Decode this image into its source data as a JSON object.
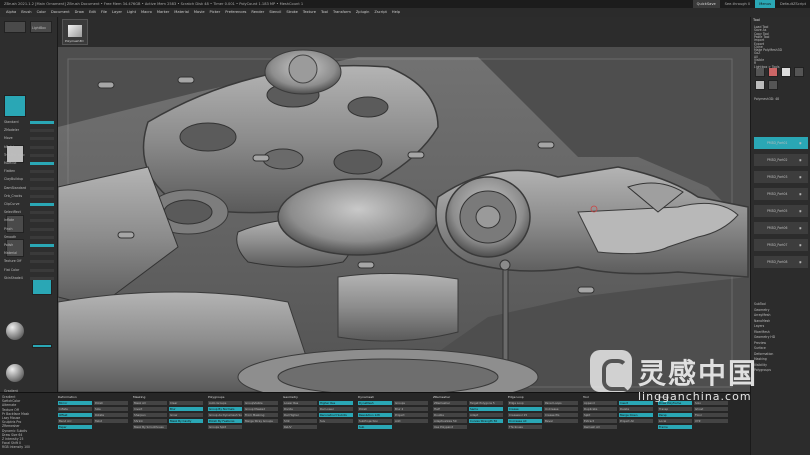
{
  "app": {
    "title": "ZBrush 2021.1.2 [Main Ornament]  ZBrush Document  • Free Mem 34.476GB • Active Mem 2583 • Scratch Disk 48 • Timer 0.001 • PolyCount 1.183 MP • MeshCount 1",
    "quicksave": "QuickSave",
    "see_through": "See-through 0",
    "menus": "Menus",
    "default_zscript": "DefaultZScript"
  },
  "menu_bar": [
    "Alpha",
    "Brush",
    "Color",
    "Document",
    "Draw",
    "Edit",
    "File",
    "Layer",
    "Light",
    "Macro",
    "Marker",
    "Material",
    "Movie",
    "Picker",
    "Preferences",
    "Render",
    "Stencil",
    "Stroke",
    "Texture",
    "Tool",
    "Transform",
    "Zplugin",
    "Zscript",
    "Help"
  ],
  "left_panel": {
    "brush_label": "Standard",
    "lightbox": "LightBox",
    "labels": [
      "Standard",
      "ZModeler",
      "Move",
      "hPolish",
      "TrimDynamic",
      "MAHcut",
      "Flatten",
      "ClayBuildup",
      "DamStandard",
      "Orb_Cracks",
      "ClipCurve",
      "SelectRect",
      "Inflate",
      "Pinch",
      "Smooth",
      "Polish",
      "Material",
      "Texture Off",
      "Flat Color",
      "SkinShade4"
    ],
    "bottom_labels": [
      "Gradient",
      "SwitchColor",
      "Alternate",
      "Bursteon",
      "ZBrush Default",
      "Basic Material",
      "Ambient Occlusion",
      "MatCap Gray",
      "Reflected Map"
    ]
  },
  "shelf": {
    "brush_label": "Polymesh3D"
  },
  "right_panel": {
    "tool_label": "Tool",
    "rows": [
      "Load Tool",
      "Save As",
      "Copy Tool",
      "Paste Tool",
      "Import",
      "Export",
      "Clone",
      "Make PolyMesh3D",
      "GoZ",
      "All",
      "Visible",
      "R",
      "Lightbox > Tools",
      "Polymesh3D: 48",
      "SubTool",
      "Geometry",
      "ArrayMesh",
      "NanoMesh",
      "Layers",
      "FiberMesh",
      "Geometry HD",
      "Preview",
      "Surface",
      "Deformation",
      "Masking",
      "Visibility",
      "Polygroups"
    ],
    "subtools": [
      "PM3D_Part01",
      "PM3D_Part02",
      "PM3D_Part03",
      "PM3D_Part04",
      "PM3D_Part05",
      "PM3D_Part06",
      "PM3D_Part07",
      "PM3D_Part08"
    ]
  },
  "bottom_bar": {
    "left_list": [
      "Gradient",
      "SwitchColor",
      "Alternate",
      "Texture Off",
      "Pr Backface Mask",
      "Lazy Mouse",
      "Sculptris Pro",
      "ZRemesher",
      "Dynamic Subdiv",
      "Draw Size 64",
      "Z Intensity 25",
      "Focal Shift 0",
      "RGB Intensity 100"
    ],
    "blocks": [
      {
        "title": "Deformation",
        "items": [
          "Mirror",
          "Polish",
          "Inflate",
          "Size",
          "Offset",
          "Rotate",
          "Bend Arc",
          "Twist",
          "Taper"
        ]
      },
      {
        "title": "Masking",
        "items": [
          "Mask All",
          "Clear",
          "Invert",
          "Blur",
          "Sharpen",
          "Grow",
          "Shrink",
          "Mask By Cavity",
          "Mask By Smoothness"
        ]
      },
      {
        "title": "Polygroups",
        "items": [
          "Auto Groups",
          "GroupVisible",
          "Group By Normals",
          "Group Masked",
          "Group As Dynamesh Sub",
          "From Masking",
          "Polish By Features",
          "Merge Stray Groups",
          "Groups Split"
        ]
      },
      {
        "title": "Geometry",
        "items": [
          "Lower Res",
          "Higher Res",
          "Divide",
          "Del Lower",
          "Del Higher",
          "Reconstruct Subdiv",
          "Smt",
          "Suv",
          "ReUV"
        ]
      },
      {
        "title": "Dynamesh",
        "items": [
          "DynaMesh",
          "Groups",
          "Polish",
          "Blur 2",
          "Resolution 128",
          "Project",
          "SubProjection",
          "Add",
          "Sub"
        ]
      },
      {
        "title": "ZRemesher",
        "items": [
          "ZRemesher",
          "Target Polygons 5",
          "Half",
          "Same",
          "Double",
          "Adapt",
          "AdaptiveSize 50",
          "Curves Strength 50",
          "Use Polypaint"
        ]
      },
      {
        "title": "Edge Loop",
        "items": [
          "Edge Loop",
          "Panel Loops",
          "Crease",
          "UnCrease",
          "CreaseLvl 15",
          "Crease PG",
          "Uncrease All",
          "Bevel",
          "Thickness"
        ]
      },
      {
        "title": "Tool",
        "items": [
          "Append",
          "Insert",
          "Duplicate",
          "Delete",
          "Split",
          "Merge Down",
          "Extract",
          "Project All",
          "Remesh All"
        ]
      },
      {
        "title": "Display",
        "items": [
          "Draw Polyframe",
          "Solo",
          "Transp",
          "Ghost",
          "Persp",
          "Floor",
          "Local",
          "XYZ",
          "Frame"
        ]
      }
    ]
  },
  "watermark": {
    "cn": "灵感中国",
    "url": "lingganchina.com"
  },
  "colors": {
    "accent": "#2aa7b5",
    "background": "#232323",
    "model_gray": "#8a8a8a"
  }
}
